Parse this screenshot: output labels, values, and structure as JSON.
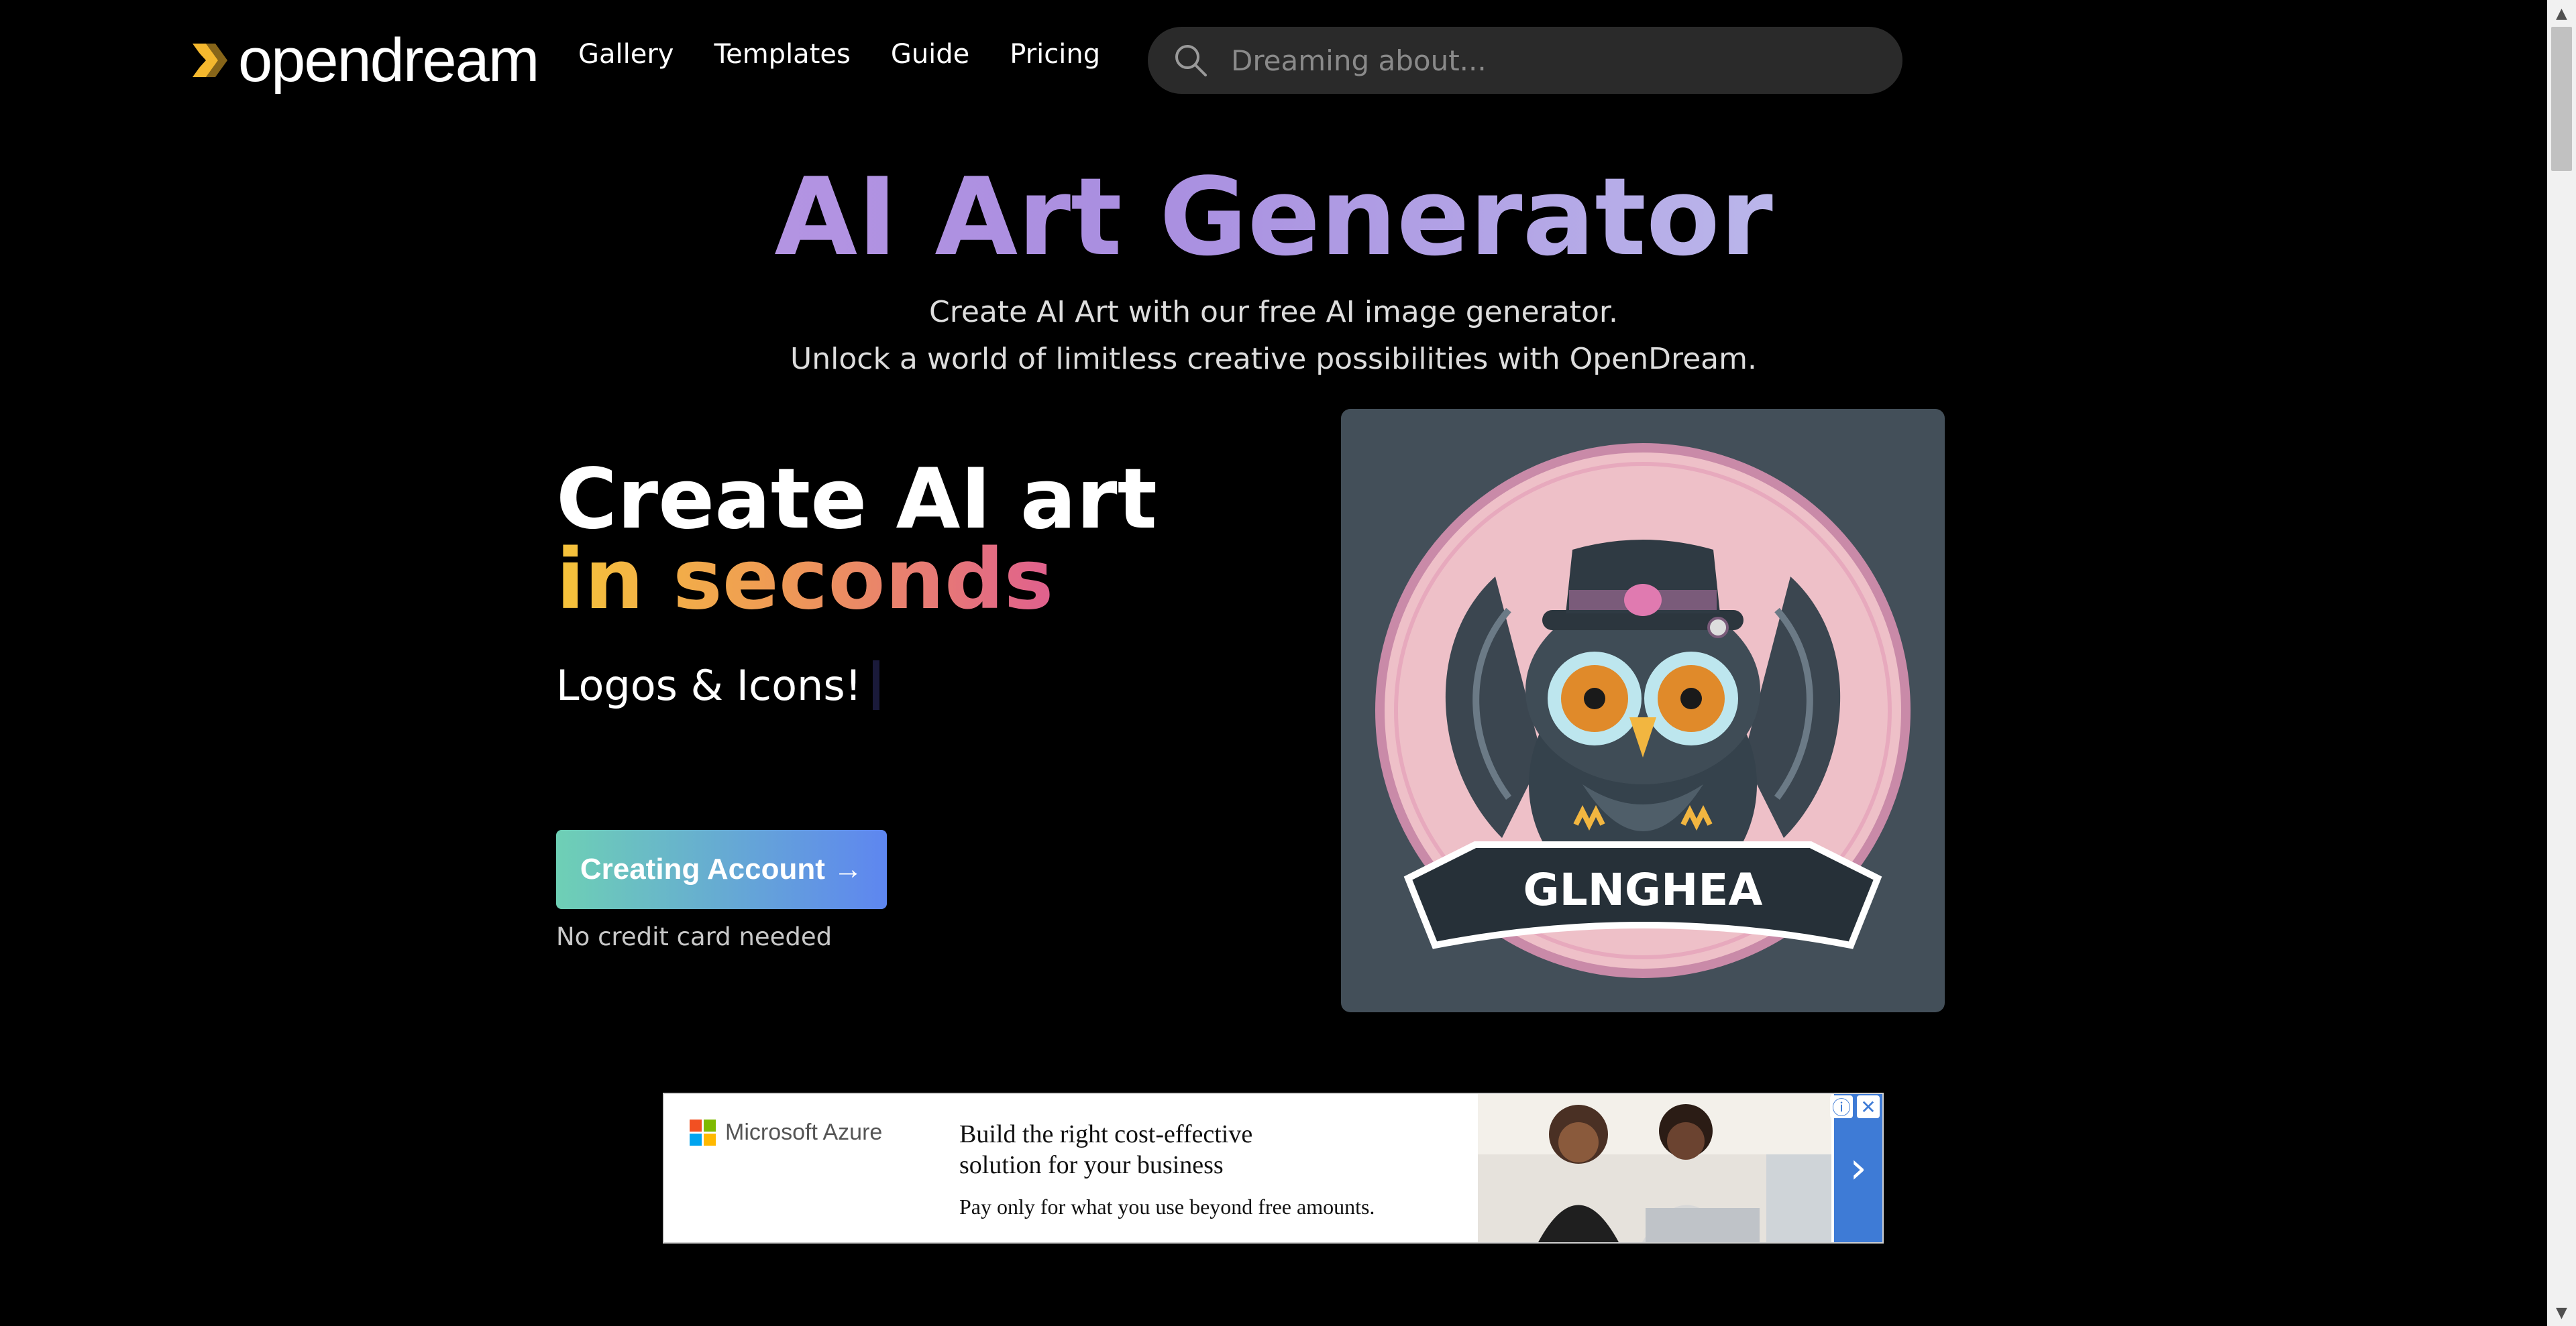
{
  "brand": {
    "name": "opendream",
    "accent": "#f5b82e"
  },
  "nav": [
    "Gallery",
    "Templates",
    "Guide",
    "Pricing"
  ],
  "search": {
    "placeholder": "Dreaming about...",
    "icon": "search-icon"
  },
  "hero": {
    "title": "AI Art Generator",
    "subtitle_1": "Create AI Art with our free AI image generator.",
    "subtitle_2": "Unlock a world of limitless creative possibilities with OpenDream."
  },
  "feature": {
    "heading_1": "Create AI art",
    "heading_2": "in seconds",
    "typing_text": "Logos & Icons!",
    "cta_label": "Creating Account →",
    "note": "No credit card needed"
  },
  "showcase": {
    "image_label": "GLNGHEA"
  },
  "ad": {
    "brand": "Microsoft Azure",
    "headline": "Build the right cost-effective solution for your business",
    "description": "Pay only for what you use beyond free amounts.",
    "info_icon": "info-icon",
    "close_icon": "close-icon",
    "arrow_icon": "chevron-right-icon"
  }
}
